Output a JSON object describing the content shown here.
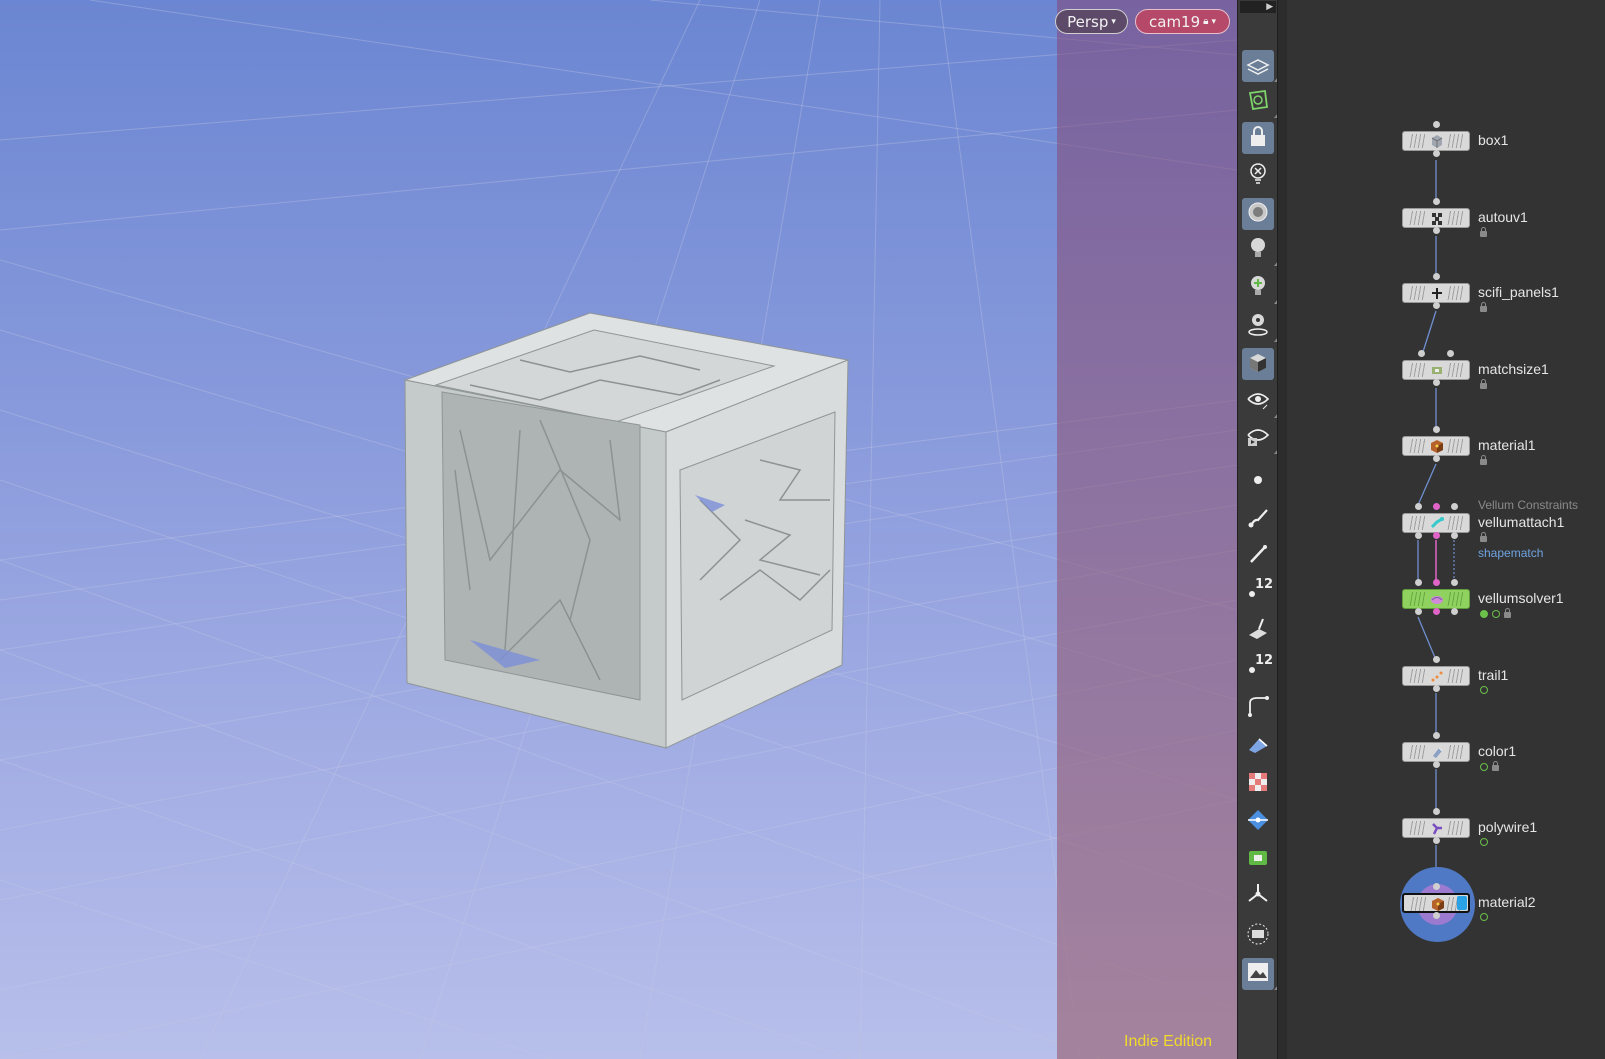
{
  "viewport": {
    "view_button": "Persp",
    "camera_button": "cam19",
    "edition": "Indie Edition"
  },
  "toolbar": {
    "items": [
      {
        "icon": "display-options-icon",
        "active": true
      },
      {
        "icon": "snapping-icon",
        "active": false
      },
      {
        "icon": "lock-camera-icon",
        "active": true
      },
      {
        "icon": "hide-icon",
        "active": false
      },
      {
        "icon": "ghost-icon",
        "active": true
      },
      {
        "icon": "light-icon",
        "active": false
      },
      {
        "icon": "add-light-icon",
        "active": false
      },
      {
        "icon": "point-light-icon",
        "active": false
      },
      {
        "icon": "shading-icon",
        "active": true
      },
      {
        "icon": "visibility-icon",
        "active": false
      },
      {
        "icon": "render-visibility-icon",
        "active": false
      },
      {
        "icon": "point-icon",
        "active": false
      },
      {
        "icon": "brush-icon",
        "active": false
      },
      {
        "icon": "pen-icon",
        "active": false
      },
      {
        "icon": "point-numbers-icon",
        "active": false,
        "text": "12"
      },
      {
        "icon": "normals-icon",
        "active": false
      },
      {
        "icon": "primitive-numbers-icon",
        "active": false,
        "text": "12"
      },
      {
        "icon": "curve-icon",
        "active": false
      },
      {
        "icon": "plane-icon",
        "active": false
      },
      {
        "icon": "uv-checker-icon",
        "active": false
      },
      {
        "icon": "handle-icon",
        "active": false
      },
      {
        "icon": "template-icon",
        "active": false
      },
      {
        "icon": "transform-icon",
        "active": false
      },
      {
        "icon": "safe-area-icon",
        "active": false
      },
      {
        "icon": "background-image-icon",
        "active": true
      }
    ]
  },
  "network": {
    "nodes": [
      {
        "name": "box1",
        "icon": "box-icon"
      },
      {
        "name": "autouv1",
        "icon": "checker-icon"
      },
      {
        "name": "scifi_panels1",
        "icon": "panels-icon"
      },
      {
        "name": "matchsize1",
        "icon": "matchsize-icon"
      },
      {
        "name": "material1",
        "icon": "material-icon"
      },
      {
        "name": "vellumattach1",
        "icon": "vellum-attach-icon",
        "subtitle": "Vellum Constraints",
        "extra": "shapematch"
      },
      {
        "name": "vellumsolver1",
        "icon": "vellum-solver-icon"
      },
      {
        "name": "trail1",
        "icon": "trail-icon"
      },
      {
        "name": "color1",
        "icon": "color-icon"
      },
      {
        "name": "polywire1",
        "icon": "polywire-icon"
      },
      {
        "name": "material2",
        "icon": "material-icon"
      }
    ]
  },
  "colors": {
    "edition_text": "#f0da2b",
    "camera_button": "#b6486a",
    "solver_node": "#8fd25f",
    "display_flag": "#29a3e6",
    "pink_wire": "#e064c8",
    "subtitle_text": "#8a8a8a",
    "extra_text": "#6fa3e0"
  }
}
